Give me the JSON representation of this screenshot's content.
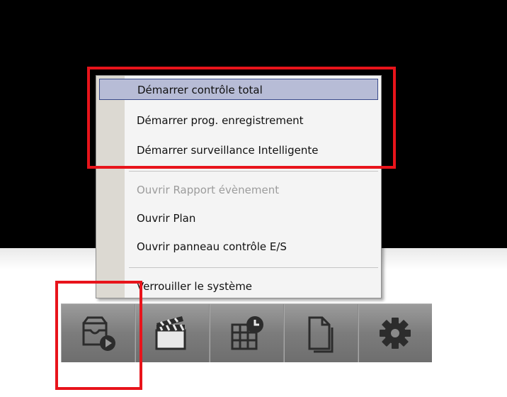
{
  "context_menu": {
    "items": [
      {
        "label": "Démarrer contrôle total",
        "state": "highlighted"
      },
      {
        "label": "Démarrer prog. enregistrement",
        "state": "normal"
      },
      {
        "label": "Démarrer surveillance Intelligente",
        "state": "normal"
      },
      {
        "label": "Ouvrir Rapport évènement",
        "state": "disabled"
      },
      {
        "label": "Ouvrir Plan",
        "state": "normal"
      },
      {
        "label": "Ouvrir panneau contrôle E/S",
        "state": "normal"
      },
      {
        "label": "Verrouiller le système",
        "state": "normal"
      }
    ]
  },
  "toolbar": {
    "buttons": [
      {
        "icon": "monitoring-start-icon"
      },
      {
        "icon": "clapperboard-icon"
      },
      {
        "icon": "schedule-icon"
      },
      {
        "icon": "document-icon"
      },
      {
        "icon": "gear-icon"
      }
    ]
  },
  "colors": {
    "annotation": "#e8141b",
    "menu_highlight": "#b7bcd6",
    "toolbar": "#7c7c7c"
  }
}
